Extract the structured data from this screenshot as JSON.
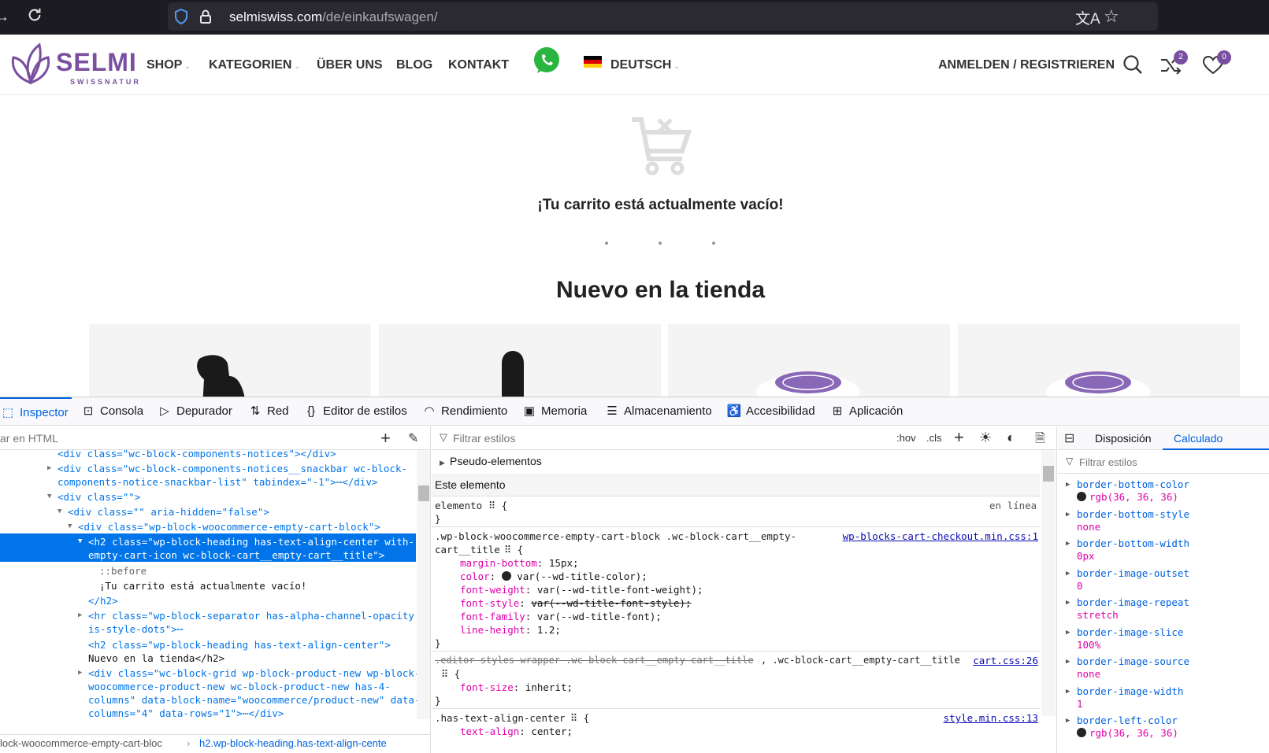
{
  "browser": {
    "url_host": "selmiswiss.com",
    "url_path": "/de/einkaufswagen/"
  },
  "header": {
    "logo_main": "SELMI",
    "logo_sub": "SWISSNATUR",
    "nav": {
      "shop": "SHOP",
      "kategorien": "KATEGORIEN",
      "ueber_uns": "ÜBER UNS",
      "blog": "BLOG",
      "kontakt": "KONTAKT",
      "language": "DEUTSCH"
    },
    "login": "ANMELDEN / REGISTRIEREN",
    "compare_count": "2",
    "wishlist_count": "0"
  },
  "page": {
    "empty_cart_text": "¡Tu carrito está actualmente vacío!",
    "new_title": "Nuevo en la tienda"
  },
  "devtools": {
    "tabs": {
      "inspector": "Inspector",
      "consola": "Consola",
      "depurador": "Depurador",
      "red": "Red",
      "editor": "Editor de estilos",
      "rendimiento": "Rendimiento",
      "memoria": "Memoria",
      "almacenamiento": "Almacenamiento",
      "accesibilidad": "Accesibilidad",
      "aplicacion": "Aplicación"
    },
    "html_search_placeholder": "ar en HTML",
    "html_lines": [
      {
        "text": "<div class=\"wc-block-components-notices\"></div>"
      },
      {
        "text": "<div class=\"wc-block-components-notices__snackbar wc-block-"
      },
      {
        "text": "components-notice-snackbar-list\" tabindex=\"-1\">⋯</div>"
      },
      {
        "text": "<div class=\"\">"
      },
      {
        "text": "<div class=\"\" aria-hidden=\"false\">"
      },
      {
        "text": "<div class=\"wp-block-woocommerce-empty-cart-block\">"
      },
      {
        "text": "<h2 class=\"wp-block-heading has-text-align-center with-"
      },
      {
        "text": "empty-cart-icon wc-block-cart__empty-cart__title\">"
      },
      {
        "text": "::before"
      },
      {
        "text": "¡Tu carrito está actualmente vacío!"
      },
      {
        "text": "</h2>"
      },
      {
        "text": "<hr class=\"wp-block-separator has-alpha-channel-opacity"
      },
      {
        "text": "is-style-dots\">⋯"
      },
      {
        "text": "<h2 class=\"wp-block-heading has-text-align-center\">"
      },
      {
        "text": "Nuevo en la tienda</h2>"
      },
      {
        "text": "<div class=\"wc-block-grid wp-block-product-new wp-block-"
      },
      {
        "text": "woocommerce-product-new wc-block-product-new has-4-"
      },
      {
        "text": "columns\" data-block-name=\"woocommerce/product-new\" data-"
      },
      {
        "text": "columns=\"4\" data-rows=\"1\">⋯</div>"
      }
    ],
    "breadcrumb": {
      "a": "lock-woocommerce-empty-cart-bloc",
      "b": "h2.wp-block-heading.has-text-align-cente"
    },
    "rules": {
      "filter_placeholder": "Filtrar estilos",
      "hov": ":hov",
      "cls": ".cls",
      "pseudo": "Pseudo-elementos",
      "this_element": "Este elemento",
      "elemento": "elemento",
      "en_linea": "en línea",
      "sel1a": ".wp-block-woocommerce-empty-cart-block .wc-block-cart__empty-",
      "sel1b": "cart__title",
      "src1": "wp-blocks-cart-checkout.min.css:1",
      "decl1": [
        {
          "p": "margin-bottom",
          "v": "15px;"
        },
        {
          "p": "color",
          "v": "var(--wd-title-color);"
        },
        {
          "p": "font-weight",
          "v": "var(--wd-title-font-weight);"
        },
        {
          "p": "font-style",
          "v": "var(--wd-title-font-style);"
        },
        {
          "p": "font-family",
          "v": "var(--wd-title-font);"
        },
        {
          "p": "line-height",
          "v": "1.2;"
        }
      ],
      "sel2a": ".editor-styles-wrapper .wc-block-cart__empty-cart__title",
      "sel2b": ", .wc-block-cart__empty-cart__title",
      "src2": "cart.css:26",
      "decl2": {
        "p": "font-size",
        "v": "inherit;"
      },
      "sel3": ".has-text-align-center",
      "src3": "style.min.css:13",
      "decl3": {
        "p": "text-align",
        "v": "center;"
      }
    },
    "computed": {
      "tab_layout": "Disposición",
      "tab_computed": "Calculado",
      "filter_placeholder": "Filtrar estilos",
      "items": [
        {
          "name": "border-bottom-color",
          "value": "rgb(36, 36, 36)"
        },
        {
          "name": "border-bottom-style",
          "value": "none"
        },
        {
          "name": "border-bottom-width",
          "value": "0px"
        },
        {
          "name": "border-image-outset",
          "value": "0"
        },
        {
          "name": "border-image-repeat",
          "value": "stretch"
        },
        {
          "name": "border-image-slice",
          "value": "100%"
        },
        {
          "name": "border-image-source",
          "value": "none"
        },
        {
          "name": "border-image-width",
          "value": "1"
        },
        {
          "name": "border-left-color",
          "value": "rgb(36, 36, 36)"
        }
      ]
    }
  }
}
